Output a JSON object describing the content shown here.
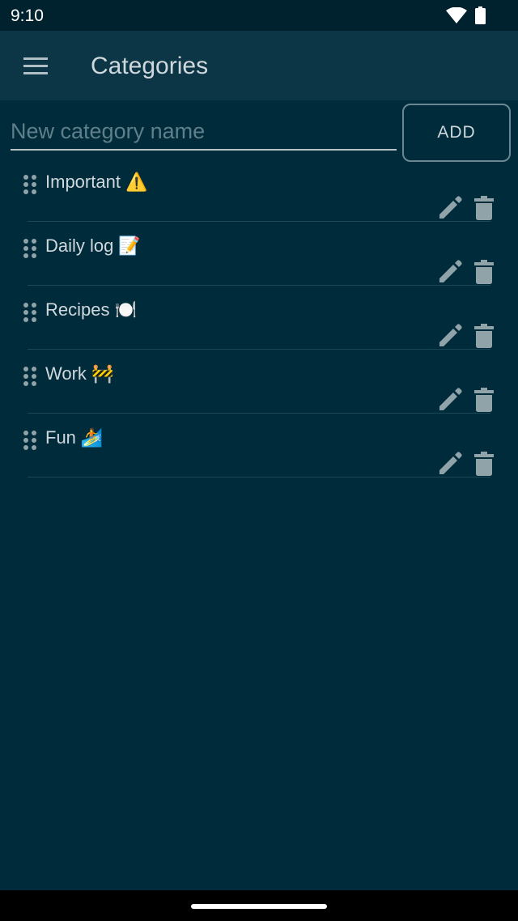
{
  "status_bar": {
    "time": "9:10",
    "wifi_icon": "wifi-icon",
    "battery_icon": "battery-icon"
  },
  "app_bar": {
    "menu_icon": "menu-icon",
    "title": "Categories"
  },
  "new_category": {
    "value": "",
    "placeholder": "New category name",
    "add_label": "ADD"
  },
  "categories": [
    {
      "name": "Important",
      "emoji": "⚠️"
    },
    {
      "name": "Daily log",
      "emoji": "📝"
    },
    {
      "name": "Recipes",
      "emoji": "🍽️"
    },
    {
      "name": "Work",
      "emoji": "🚧"
    },
    {
      "name": "Fun",
      "emoji": "🏄"
    }
  ],
  "row_icons": {
    "drag": "drag-handle-icon",
    "edit": "pencil-icon",
    "delete": "trash-icon"
  },
  "colors": {
    "background": "#002b3b",
    "app_bar": "#0c3645",
    "status_bar": "#00222e",
    "text": "#cfd8dc",
    "icon": "#8fa3a9"
  }
}
